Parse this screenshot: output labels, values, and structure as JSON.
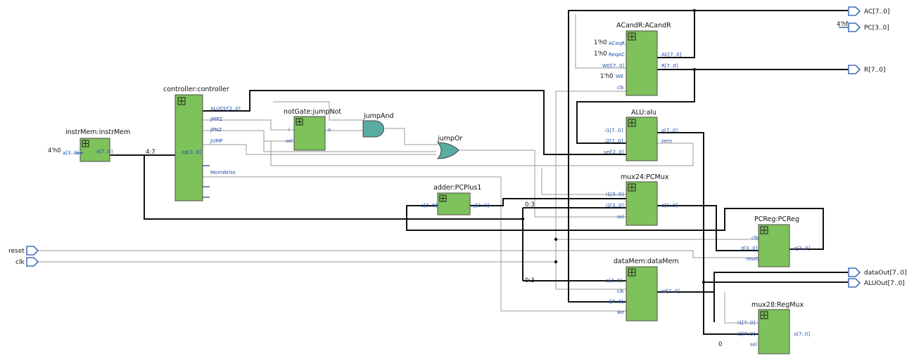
{
  "modules": {
    "instrMem": {
      "title": "instrMem:instrMem",
      "in": [
        "a[3..0]"
      ],
      "out": [
        "o[7..0]"
      ]
    },
    "controller": {
      "title": "controller:controller",
      "in": [
        "op[3..0]"
      ],
      "out": [
        "ALUCtr[2..0]",
        "JMPZ",
        "JPNZ",
        "JUMP",
        "MemWrite"
      ]
    },
    "notGate": {
      "title": "notGate:jumpNot",
      "in": [
        "i",
        "sel"
      ],
      "out": [
        "o"
      ]
    },
    "jumpAnd": {
      "title": "jumpAnd"
    },
    "jumpOr": {
      "title": "jumpOr"
    },
    "ACandR": {
      "title": "ACandR:ACandR",
      "in": [
        "ACeqR",
        "ReqAC",
        "WD[7..0]",
        "WE",
        "clk"
      ],
      "out": [
        "AC[7..0]",
        "R[7..0]"
      ]
    },
    "alu": {
      "title": "ALU:alu",
      "in": [
        "i1[7..0]",
        "i2[7..0]",
        "sel[2..0]"
      ],
      "out": [
        "o[7..0]",
        "zero"
      ]
    },
    "pcmux": {
      "title": "mux24:PCMux",
      "in": [
        "i1[3..0]",
        "i2[3..0]",
        "sel"
      ],
      "out": [
        "o[3..0]"
      ]
    },
    "adder": {
      "title": "adder:PCPlus1",
      "in": [
        "a[3..0]"
      ],
      "out": [
        "y[3..0]"
      ]
    },
    "pcreg": {
      "title": "PCReg:PCReg",
      "in": [
        "clk",
        "d[3..0]",
        "reset"
      ],
      "out": [
        "q[3..0]"
      ]
    },
    "datamem": {
      "title": "dataMem:dataMem",
      "in": [
        "a[3..0]",
        "clk",
        "i[7..0]",
        "we"
      ],
      "out": [
        "rd[7..0]"
      ]
    },
    "regmux": {
      "title": "mux28:RegMux",
      "in": [
        "i1[7..0]",
        "i2[7..0]",
        "sel"
      ],
      "out": [
        "o[7..0]"
      ]
    }
  },
  "constants": {
    "instr_addr": "4'h0",
    "aceqr": "1'h0",
    "reqac": "1'h0",
    "we": "1'h0",
    "pc_const": "4'hf",
    "op_slice": "4:7",
    "pcmux_slice": "0:3",
    "datamem_slice": "0:3",
    "regmux_sel": "0"
  },
  "inputs": {
    "reset": "reset",
    "clk": "clk"
  },
  "outputs": {
    "ac": "AC[7..0]",
    "pc": "PC[3..0]",
    "r": "R[7..0]",
    "dataout": "dataOut[7..0]",
    "aluout": "ALUOut[7..0]"
  }
}
